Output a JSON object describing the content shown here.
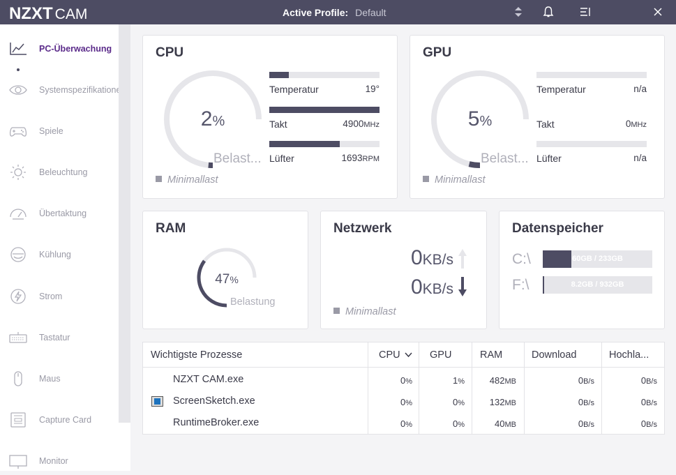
{
  "titlebar": {
    "logo_bold": "NZXT",
    "logo_light": "CAM",
    "profile_label": "Active Profile:",
    "profile_value": "Default",
    "bg_color": "#4d4c63"
  },
  "sidebar": {
    "items": [
      {
        "label": "PC-Überwachung",
        "icon": "line-chart-icon"
      },
      {
        "label": "Systemspezifikationen",
        "icon": "eye-icon"
      },
      {
        "label": "Spiele",
        "icon": "gamepad-icon"
      },
      {
        "label": "Beleuchtung",
        "icon": "sun-icon"
      },
      {
        "label": "Übertaktung",
        "icon": "speedometer-icon"
      },
      {
        "label": "Kühlung",
        "icon": "cooling-icon"
      },
      {
        "label": "Strom",
        "icon": "lightning-icon"
      },
      {
        "label": "Tastatur",
        "icon": "keyboard-icon"
      },
      {
        "label": "Maus",
        "icon": "mouse-icon"
      },
      {
        "label": "Capture Card",
        "icon": "capture-card-icon"
      },
      {
        "label": "Monitor",
        "icon": "monitor-icon"
      }
    ],
    "active_color": "#5b2b8a"
  },
  "cpu": {
    "title": "CPU",
    "load_value": "2",
    "load_unit": "%",
    "load_fraction": 0.02,
    "load_label": "Belast...",
    "temp_label": "Temperatur",
    "temp_value": "19°",
    "temp_fraction": 0.18,
    "clock_label": "Takt",
    "clock_value": "4900",
    "clock_unit": "MHz",
    "clock_fraction": 1.0,
    "fan_label": "Lüfter",
    "fan_value": "1693",
    "fan_unit": "RPM",
    "fan_fraction": 0.64,
    "mode": "Minimallast"
  },
  "gpu": {
    "title": "GPU",
    "load_value": "5",
    "load_unit": "%",
    "load_fraction": 0.05,
    "load_label": "Belast...",
    "temp_label": "Temperatur",
    "temp_value": "n/a",
    "clock_label": "Takt",
    "clock_value": "0",
    "clock_unit": "MHz",
    "fan_label": "Lüfter",
    "fan_value": "n/a",
    "mode": "Minimallast"
  },
  "ram": {
    "title": "RAM",
    "value": "47",
    "unit": "%",
    "fraction": 0.47,
    "label": "Belastung"
  },
  "network": {
    "title": "Netzwerk",
    "upload_value": "0",
    "upload_unit": "KB/s",
    "download_value": "0",
    "download_unit": "KB/s",
    "mode": "Minimallast"
  },
  "storage": {
    "title": "Datenspeicher",
    "drives": [
      {
        "label": "C:\\",
        "usage": "60GB / 233GB",
        "fraction": 0.26
      },
      {
        "label": "F:\\",
        "usage": "8.2GB / 932GB",
        "fraction": 0.01
      }
    ]
  },
  "processes": {
    "headers": {
      "name": "Wichtigste Prozesse",
      "cpu": "CPU",
      "gpu": "GPU",
      "ram": "RAM",
      "download": "Download",
      "upload": "Hochla..."
    },
    "rows": [
      {
        "name": "NZXT CAM.exe",
        "cpu": "0",
        "cpu_u": "%",
        "gpu": "1",
        "gpu_u": "%",
        "ram": "482",
        "ram_u": "MB",
        "dl": "0",
        "dl_u": "B/s",
        "ul": "0",
        "ul_u": "B/s"
      },
      {
        "name": "ScreenSketch.exe",
        "cpu": "0",
        "cpu_u": "%",
        "gpu": "0",
        "gpu_u": "%",
        "ram": "132",
        "ram_u": "MB",
        "dl": "0",
        "dl_u": "B/s",
        "ul": "0",
        "ul_u": "B/s"
      },
      {
        "name": "RuntimeBroker.exe",
        "cpu": "0",
        "cpu_u": "%",
        "gpu": "0",
        "gpu_u": "%",
        "ram": "40",
        "ram_u": "MB",
        "dl": "0",
        "dl_u": "B/s",
        "ul": "0",
        "ul_u": "B/s"
      }
    ]
  }
}
